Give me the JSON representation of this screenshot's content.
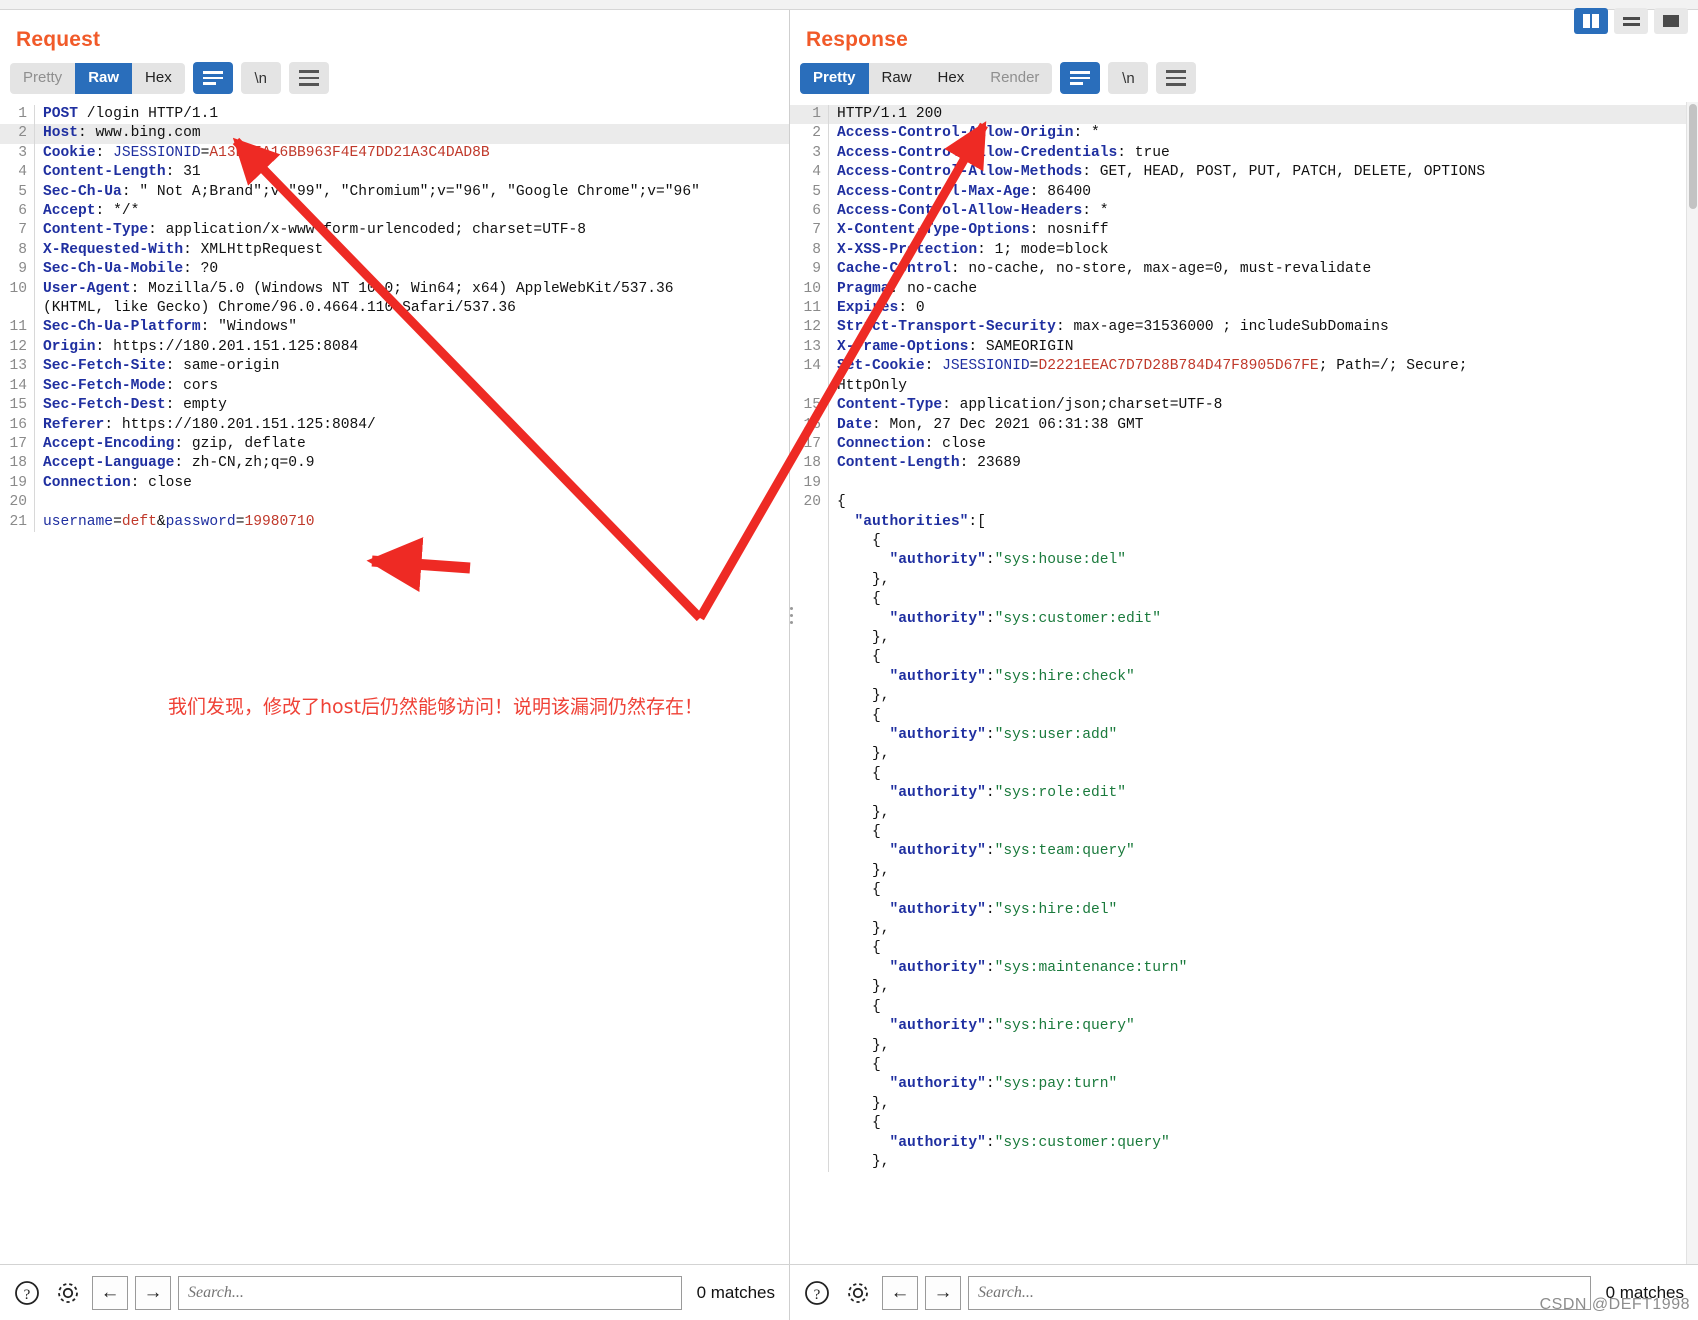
{
  "window": {
    "layout_buttons": [
      {
        "name": "split-vertical",
        "active": true
      },
      {
        "name": "rows",
        "active": false
      },
      {
        "name": "single",
        "active": false
      }
    ]
  },
  "request": {
    "title": "Request",
    "tabs": [
      {
        "label": "Pretty",
        "state": "dim"
      },
      {
        "label": "Raw",
        "state": "active"
      },
      {
        "label": "Hex",
        "state": "normal"
      }
    ],
    "wrap_button": "wrap-lines-icon",
    "newline_button": "\\n",
    "menu_button": "hamburger-icon",
    "lines": [
      {
        "n": "1",
        "html": "<span class='k'>POST</span> <span class='v'>/login HTTP/1.1</span>",
        "hl": false
      },
      {
        "n": "2",
        "html": "<span class='k'>Host</span>: <span class='v'>www.bing.com</span>",
        "hl": true
      },
      {
        "n": "3",
        "html": "<span class='k'>Cookie</span>: <span class='blue'>JSESSIONID</span>=<span class='red'>A13D95A16BB963F4E47DD21A3C4DAD8B</span>",
        "hl": false
      },
      {
        "n": "4",
        "html": "<span class='k'>Content-Length</span>: <span class='v'>31</span>",
        "hl": false
      },
      {
        "n": "5",
        "html": "<span class='k'>Sec-Ch-Ua</span>: <span class='v'>\" Not A;Brand\";v=\"99\", \"Chromium\";v=\"96\", \"Google Chrome\";v=\"96\"</span>",
        "hl": false
      },
      {
        "n": "6",
        "html": "<span class='k'>Accept</span>: <span class='v'>*/*</span>",
        "hl": false
      },
      {
        "n": "7",
        "html": "<span class='k'>Content-Type</span>: <span class='v'>application/x-www-form-urlencoded; charset=UTF-8</span>",
        "hl": false
      },
      {
        "n": "8",
        "html": "<span class='k'>X-Requested-With</span>: <span class='v'>XMLHttpRequest</span>",
        "hl": false
      },
      {
        "n": "9",
        "html": "<span class='k'>Sec-Ch-Ua-Mobile</span>: <span class='v'>?0</span>",
        "hl": false
      },
      {
        "n": "10",
        "html": "<span class='k'>User-Agent</span>: <span class='v'>Mozilla/5.0 (Windows NT 10.0; Win64; x64) AppleWebKit/537.36</span>",
        "hl": false
      },
      {
        "n": "",
        "html": "<span class='v'>(KHTML, like Gecko) Chrome/96.0.4664.110 Safari/537.36</span>",
        "hl": false
      },
      {
        "n": "11",
        "html": "<span class='k'>Sec-Ch-Ua-Platform</span>: <span class='v'>\"Windows\"</span>",
        "hl": false
      },
      {
        "n": "12",
        "html": "<span class='k'>Origin</span>: <span class='v'>https://180.201.151.125:8084</span>",
        "hl": false
      },
      {
        "n": "13",
        "html": "<span class='k'>Sec-Fetch-Site</span>: <span class='v'>same-origin</span>",
        "hl": false
      },
      {
        "n": "14",
        "html": "<span class='k'>Sec-Fetch-Mode</span>: <span class='v'>cors</span>",
        "hl": false
      },
      {
        "n": "15",
        "html": "<span class='k'>Sec-Fetch-Dest</span>: <span class='v'>empty</span>",
        "hl": false
      },
      {
        "n": "16",
        "html": "<span class='k'>Referer</span>: <span class='v'>https://180.201.151.125:8084/</span>",
        "hl": false
      },
      {
        "n": "17",
        "html": "<span class='k'>Accept-Encoding</span>: <span class='v'>gzip, deflate</span>",
        "hl": false
      },
      {
        "n": "18",
        "html": "<span class='k'>Accept-Language</span>: <span class='v'>zh-CN,zh;q=0.9</span>",
        "hl": false
      },
      {
        "n": "19",
        "html": "<span class='k'>Connection</span>: <span class='v'>close</span>",
        "hl": false
      },
      {
        "n": "20",
        "html": "",
        "hl": false
      },
      {
        "n": "21",
        "html": "<span class='blue'>username</span>=<span class='red'>deft</span><span class='v'>&amp;</span><span class='blue'>password</span>=<span class='red'>19980710</span>",
        "hl": false
      }
    ]
  },
  "response": {
    "title": "Response",
    "tabs": [
      {
        "label": "Pretty",
        "state": "active"
      },
      {
        "label": "Raw",
        "state": "normal"
      },
      {
        "label": "Hex",
        "state": "normal"
      },
      {
        "label": "Render",
        "state": "dim"
      }
    ],
    "wrap_button": "wrap-lines-icon",
    "newline_button": "\\n",
    "menu_button": "hamburger-icon",
    "lines": [
      {
        "n": "1",
        "html": "<span class='v'>HTTP/1.1 200</span>",
        "hl": true
      },
      {
        "n": "2",
        "html": "<span class='k'>Access-Control-Allow-Origin</span>: <span class='v'>*</span>",
        "hl": false
      },
      {
        "n": "3",
        "html": "<span class='k'>Access-Control-Allow-Credentials</span>: <span class='v'>true</span>",
        "hl": false
      },
      {
        "n": "4",
        "html": "<span class='k'>Access-Control-Allow-Methods</span>: <span class='v'>GET, HEAD, POST, PUT, PATCH, DELETE, OPTIONS</span>",
        "hl": false
      },
      {
        "n": "5",
        "html": "<span class='k'>Access-Control-Max-Age</span>: <span class='v'>86400</span>",
        "hl": false
      },
      {
        "n": "6",
        "html": "<span class='k'>Access-Control-Allow-Headers</span>: <span class='v'>*</span>",
        "hl": false
      },
      {
        "n": "7",
        "html": "<span class='k'>X-Content-Type-Options</span>: <span class='v'>nosniff</span>",
        "hl": false
      },
      {
        "n": "8",
        "html": "<span class='k'>X-XSS-Protection</span>: <span class='v'>1; mode=block</span>",
        "hl": false
      },
      {
        "n": "9",
        "html": "<span class='k'>Cache-Control</span>: <span class='v'>no-cache, no-store, max-age=0, must-revalidate</span>",
        "hl": false
      },
      {
        "n": "10",
        "html": "<span class='k'>Pragma</span>: <span class='v'>no-cache</span>",
        "hl": false
      },
      {
        "n": "11",
        "html": "<span class='k'>Expires</span>: <span class='v'>0</span>",
        "hl": false
      },
      {
        "n": "12",
        "html": "<span class='k'>Strict-Transport-Security</span>: <span class='v'>max-age=31536000 ; includeSubDomains</span>",
        "hl": false
      },
      {
        "n": "13",
        "html": "<span class='k'>X-Frame-Options</span>: <span class='v'>SAMEORIGIN</span>",
        "hl": false
      },
      {
        "n": "14",
        "html": "<span class='k'>Set-Cookie</span>: <span class='blue'>JSESSIONID</span>=<span class='red'>D2221EEAC7D7D28B784D47F8905D67FE</span><span class='v'>; Path=/; Secure;</span>",
        "hl": false
      },
      {
        "n": "",
        "html": "<span class='v'>HttpOnly</span>",
        "hl": false
      },
      {
        "n": "15",
        "html": "<span class='k'>Content-Type</span>: <span class='v'>application/json;charset=UTF-8</span>",
        "hl": false
      },
      {
        "n": "16",
        "html": "<span class='k'>Date</span>: <span class='v'>Mon, 27 Dec 2021 06:31:38 GMT</span>",
        "hl": false
      },
      {
        "n": "17",
        "html": "<span class='k'>Connection</span>: <span class='v'>close</span>",
        "hl": false
      },
      {
        "n": "18",
        "html": "<span class='k'>Content-Length</span>: <span class='v'>23689</span>",
        "hl": false
      },
      {
        "n": "19",
        "html": "",
        "hl": false
      },
      {
        "n": "20",
        "html": "<span class='v'>{</span>",
        "hl": false
      },
      {
        "n": "",
        "html": "<span class='v'>  </span><span class='jkey'>\"authorities\"</span><span class='v'>:[</span>",
        "hl": false
      },
      {
        "n": "",
        "html": "<span class='v'>    {</span>",
        "hl": false
      },
      {
        "n": "",
        "html": "<span class='v'>      </span><span class='jkey'>\"authority\"</span><span class='v'>:</span><span class='jval'>\"sys:house:del\"</span>",
        "hl": false
      },
      {
        "n": "",
        "html": "<span class='v'>    },</span>",
        "hl": false
      },
      {
        "n": "",
        "html": "<span class='v'>    {</span>",
        "hl": false
      },
      {
        "n": "",
        "html": "<span class='v'>      </span><span class='jkey'>\"authority\"</span><span class='v'>:</span><span class='jval'>\"sys:customer:edit\"</span>",
        "hl": false
      },
      {
        "n": "",
        "html": "<span class='v'>    },</span>",
        "hl": false
      },
      {
        "n": "",
        "html": "<span class='v'>    {</span>",
        "hl": false
      },
      {
        "n": "",
        "html": "<span class='v'>      </span><span class='jkey'>\"authority\"</span><span class='v'>:</span><span class='jval'>\"sys:hire:check\"</span>",
        "hl": false
      },
      {
        "n": "",
        "html": "<span class='v'>    },</span>",
        "hl": false
      },
      {
        "n": "",
        "html": "<span class='v'>    {</span>",
        "hl": false
      },
      {
        "n": "",
        "html": "<span class='v'>      </span><span class='jkey'>\"authority\"</span><span class='v'>:</span><span class='jval'>\"sys:user:add\"</span>",
        "hl": false
      },
      {
        "n": "",
        "html": "<span class='v'>    },</span>",
        "hl": false
      },
      {
        "n": "",
        "html": "<span class='v'>    {</span>",
        "hl": false
      },
      {
        "n": "",
        "html": "<span class='v'>      </span><span class='jkey'>\"authority\"</span><span class='v'>:</span><span class='jval'>\"sys:role:edit\"</span>",
        "hl": false
      },
      {
        "n": "",
        "html": "<span class='v'>    },</span>",
        "hl": false
      },
      {
        "n": "",
        "html": "<span class='v'>    {</span>",
        "hl": false
      },
      {
        "n": "",
        "html": "<span class='v'>      </span><span class='jkey'>\"authority\"</span><span class='v'>:</span><span class='jval'>\"sys:team:query\"</span>",
        "hl": false
      },
      {
        "n": "",
        "html": "<span class='v'>    },</span>",
        "hl": false
      },
      {
        "n": "",
        "html": "<span class='v'>    {</span>",
        "hl": false
      },
      {
        "n": "",
        "html": "<span class='v'>      </span><span class='jkey'>\"authority\"</span><span class='v'>:</span><span class='jval'>\"sys:hire:del\"</span>",
        "hl": false
      },
      {
        "n": "",
        "html": "<span class='v'>    },</span>",
        "hl": false
      },
      {
        "n": "",
        "html": "<span class='v'>    {</span>",
        "hl": false
      },
      {
        "n": "",
        "html": "<span class='v'>      </span><span class='jkey'>\"authority\"</span><span class='v'>:</span><span class='jval'>\"sys:maintenance:turn\"</span>",
        "hl": false
      },
      {
        "n": "",
        "html": "<span class='v'>    },</span>",
        "hl": false
      },
      {
        "n": "",
        "html": "<span class='v'>    {</span>",
        "hl": false
      },
      {
        "n": "",
        "html": "<span class='v'>      </span><span class='jkey'>\"authority\"</span><span class='v'>:</span><span class='jval'>\"sys:hire:query\"</span>",
        "hl": false
      },
      {
        "n": "",
        "html": "<span class='v'>    },</span>",
        "hl": false
      },
      {
        "n": "",
        "html": "<span class='v'>    {</span>",
        "hl": false
      },
      {
        "n": "",
        "html": "<span class='v'>      </span><span class='jkey'>\"authority\"</span><span class='v'>:</span><span class='jval'>\"sys:pay:turn\"</span>",
        "hl": false
      },
      {
        "n": "",
        "html": "<span class='v'>    },</span>",
        "hl": false
      },
      {
        "n": "",
        "html": "<span class='v'>    {</span>",
        "hl": false
      },
      {
        "n": "",
        "html": "<span class='v'>      </span><span class='jkey'>\"authority\"</span><span class='v'>:</span><span class='jval'>\"sys:customer:query\"</span>",
        "hl": false
      },
      {
        "n": "",
        "html": "<span class='v'>    },</span>",
        "hl": false
      }
    ]
  },
  "annotation": {
    "text": "我们发现，修改了host后仍然能够访问！说明该漏洞仍然存在！",
    "color": "#ef4136",
    "arrow_color": "#ee2a24"
  },
  "footer": {
    "left": {
      "help_icon": "question-circle-icon",
      "settings_icon": "gear-icon",
      "prev_icon": "arrow-left-icon",
      "next_icon": "arrow-right-icon",
      "search_placeholder": "Search...",
      "search_value": "",
      "matches": "0 matches"
    },
    "right": {
      "help_icon": "question-circle-icon",
      "settings_icon": "gear-icon",
      "prev_icon": "arrow-left-icon",
      "next_icon": "arrow-right-icon",
      "search_placeholder": "Search...",
      "search_value": "",
      "matches": "0 matches"
    }
  },
  "watermark": "CSDN @DEFT1998"
}
